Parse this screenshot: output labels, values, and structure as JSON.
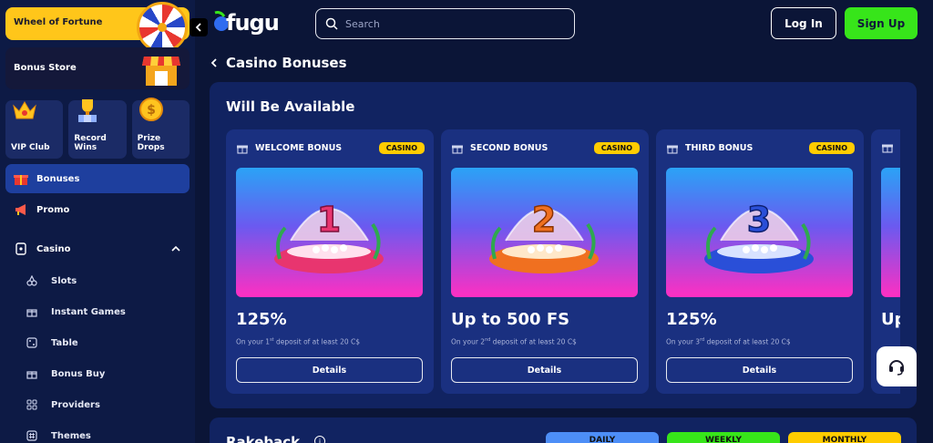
{
  "sidebar": {
    "wheel_label": "Wheel of Fortune",
    "bonus_store_label": "Bonus Store",
    "tiles": [
      {
        "label": "VIP Club",
        "icon": "crown-icon"
      },
      {
        "label": "Record Wins",
        "icon": "trophy-icon"
      },
      {
        "label": "Prize Drops",
        "icon": "coin-icon"
      }
    ],
    "nav": [
      {
        "label": "Bonuses",
        "icon": "gift-icon",
        "active": true
      },
      {
        "label": "Promo",
        "icon": "megaphone-icon",
        "active": false
      },
      {
        "label": "Casino",
        "icon": "cards-icon",
        "active": false
      }
    ],
    "casino_sub": [
      {
        "label": "Slots",
        "icon": "cherry-icon"
      },
      {
        "label": "Instant Games",
        "icon": "gift-box-icon"
      },
      {
        "label": "Table",
        "icon": "dice-icon"
      },
      {
        "label": "Bonus Buy",
        "icon": "gift-box-icon"
      },
      {
        "label": "Providers",
        "icon": "grid-icon"
      },
      {
        "label": "Themes",
        "icon": "hash-icon"
      }
    ]
  },
  "header": {
    "logo": "fugu",
    "search_placeholder": "Search",
    "login_label": "Log In",
    "signup_label": "Sign Up"
  },
  "page": {
    "title": "Casino Bonuses"
  },
  "available": {
    "title": "Will Be Available",
    "cards": [
      {
        "name": "WELCOME BONUS",
        "badge": "CASINO",
        "number": "1",
        "value": "125%",
        "desc_prefix": "On your 1",
        "desc_sup": "st",
        "desc_suffix": " deposit of at least 20 C$",
        "details_label": "Details",
        "shell_color": "#e8356f"
      },
      {
        "name": "SECOND BONUS",
        "badge": "CASINO",
        "number": "2",
        "value": "Up to 500 FS",
        "desc_prefix": "On your 2",
        "desc_sup": "nd",
        "desc_suffix": " deposit of at least 20 C$",
        "details_label": "Details",
        "shell_color": "#f07020"
      },
      {
        "name": "THIRD BONUS",
        "badge": "CASINO",
        "number": "3",
        "value": "125%",
        "desc_prefix": "On your 3",
        "desc_sup": "rd",
        "desc_suffix": " deposit of at least 20 C$",
        "details_label": "Details",
        "shell_color": "#2a4fd8"
      }
    ],
    "partial_card_value": "Up"
  },
  "rakeback": {
    "title": "Rakeback",
    "tabs": [
      {
        "label": "DAILY",
        "color": "#4d8ef7"
      },
      {
        "label": "WEEKLY",
        "color": "#37e51a"
      },
      {
        "label": "MONTHLY",
        "color": "#ffcc00"
      }
    ]
  },
  "colors": {
    "accent_green": "#37e51a",
    "badge_yellow": "#ffcc00",
    "active_nav": "#1e3f9e"
  }
}
